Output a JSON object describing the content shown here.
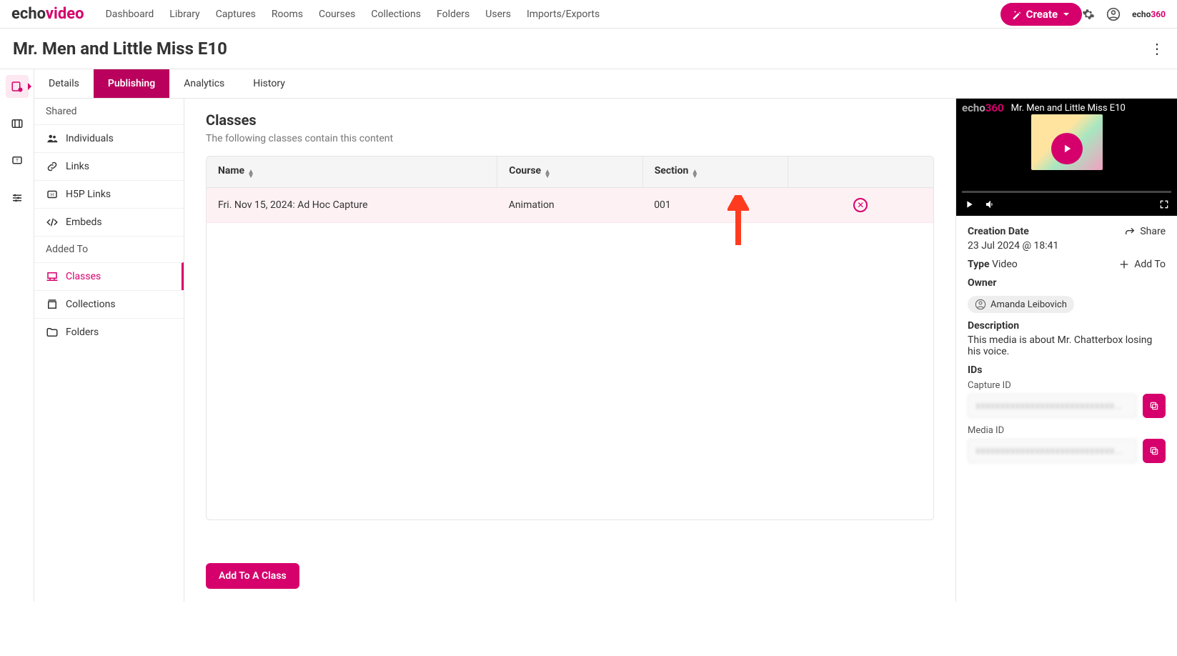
{
  "topnav": {
    "logo_a": "echo",
    "logo_b": "video",
    "links": [
      "Dashboard",
      "Library",
      "Captures",
      "Rooms",
      "Courses",
      "Collections",
      "Folders",
      "Users",
      "Imports/Exports"
    ],
    "create_label": "Create",
    "brand_small_a": "echo",
    "brand_small_b": "360"
  },
  "page": {
    "title": "Mr. Men and Little Miss E10"
  },
  "tabs": [
    "Details",
    "Publishing",
    "Analytics",
    "History"
  ],
  "sidemenu": {
    "section1": "Shared",
    "items1": [
      "Individuals",
      "Links",
      "H5P Links",
      "Embeds"
    ],
    "section2": "Added To",
    "items2": [
      "Classes",
      "Collections",
      "Folders"
    ]
  },
  "classes": {
    "heading": "Classes",
    "subtitle": "The following classes contain this content",
    "cols": [
      "Name",
      "Course",
      "Section"
    ],
    "row": {
      "name": "Fri. Nov 15, 2024: Ad Hoc Capture",
      "course": "Animation",
      "section": "001"
    },
    "add_btn": "Add To A Class"
  },
  "preview": {
    "logo_a": "echo",
    "logo_b": "360",
    "video_title": "Mr. Men and Little Miss E10"
  },
  "meta": {
    "creation_label": "Creation Date",
    "creation_value": "23 Jul 2024 @ 18:41",
    "share_label": "Share",
    "type_label": "Type",
    "type_value": "Video",
    "addto_label": "Add To",
    "owner_label": "Owner",
    "owner_value": "Amanda Leibovich",
    "desc_label": "Description",
    "desc_value": "This media is about Mr. Chatterbox losing his voice.",
    "ids_label": "IDs",
    "capture_id_label": "Capture ID",
    "capture_id_value": "xxxxxxxxxxxxxxxxxxxxxxxxxxxx...",
    "media_id_label": "Media ID",
    "media_id_value": "xxxxxxxxxxxxxxxxxxxxxxxxxxxx..."
  }
}
